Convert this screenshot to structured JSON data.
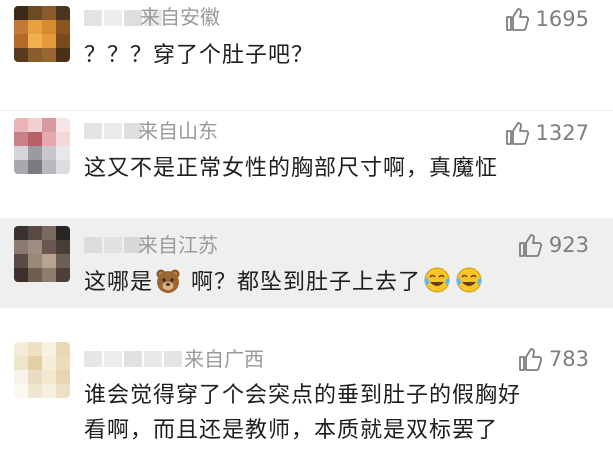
{
  "comments": [
    {
      "location": "来自安徽",
      "likes": "1695",
      "text": "？？？穿了个肚子吧？",
      "avatar_colors": [
        "#3a2a18",
        "#6b4a24",
        "#8a5a2a",
        "#4a3520",
        "#c07a34",
        "#e8a040",
        "#d68b2f",
        "#8a5420",
        "#b56a26",
        "#f0b050",
        "#e29a3c",
        "#7a4a1c",
        "#5a3a1e",
        "#8a5c2c",
        "#9a6630",
        "#4a3018"
      ]
    },
    {
      "location": "来自山东",
      "likes": "1327",
      "text": "这又不是正常女性的胸部尺寸啊，真魔怔",
      "avatar_colors": [
        "#e8b4b8",
        "#f2d0d2",
        "#d89aa0",
        "#f7e4e4",
        "#c98088",
        "#b86068",
        "#e6a8ae",
        "#f3d8da",
        "#d5d5d8",
        "#9a9aa0",
        "#c8c8cc",
        "#e8e8ea",
        "#a8a8ae",
        "#7a7a80",
        "#b8b8be",
        "#dcdce0"
      ]
    },
    {
      "location": "来自江苏",
      "likes": "923",
      "text_before": "这哪是",
      "text_after": " 啊？都坠到肚子上去了",
      "avatar_colors": [
        "#3a3230",
        "#5a4a44",
        "#7a6a62",
        "#2a2422",
        "#8a7a70",
        "#a08c80",
        "#6a5850",
        "#4a3c36",
        "#5a4c44",
        "#9a8878",
        "#b8a490",
        "#6e5e54",
        "#3c302c",
        "#705e52",
        "#8e7c6e",
        "#4e4038"
      ]
    },
    {
      "location": "来自广西",
      "likes": "783",
      "text_line1": "谁会觉得穿了个会突点的垂到肚子的假胸好",
      "text_line2": "看啊，而且还是教师，本质就是双标罢了",
      "avatar_colors": [
        "#f4ecd8",
        "#efe2c4",
        "#f8f2e2",
        "#e8d8b6",
        "#f0e6cc",
        "#e2cfa6",
        "#f6eed8",
        "#ebdcbc",
        "#f8f4ea",
        "#eadcc0",
        "#f2e8d2",
        "#e6d6b4",
        "#fbf8f0",
        "#f0e6d0",
        "#f6f0e0",
        "#ece0c6"
      ]
    }
  ]
}
